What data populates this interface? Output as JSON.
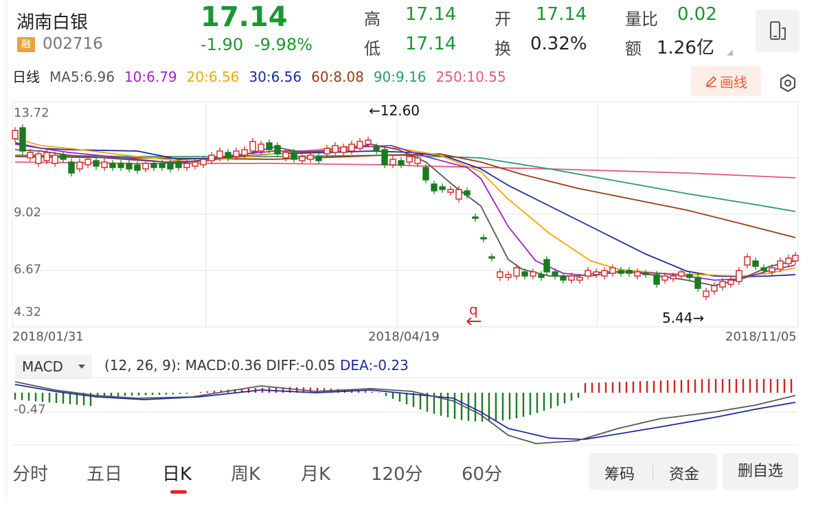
{
  "header": {
    "name": "湖南白银",
    "rong_badge": "融",
    "code": "002716",
    "price": "17.14",
    "change": "-1.90",
    "change_pct": "-9.98%",
    "stats": {
      "high_label": "高",
      "high": "17.14",
      "open_label": "开",
      "open": "17.14",
      "vol_ratio_label": "量比",
      "vol_ratio": "0.02",
      "low_label": "低",
      "low": "17.14",
      "turnover_label": "换",
      "turnover": "0.32%",
      "amount_label": "额",
      "amount": "1.26亿"
    },
    "switch_icon": "phone-landscape-icon"
  },
  "ma_bar": {
    "period": "日线",
    "ma5": "MA5:6.96",
    "ma10": "10:6.79",
    "ma20": "20:6.56",
    "ma30": "30:6.56",
    "ma60": "60:8.08",
    "ma90": "90:9.16",
    "ma250": "250:10.55",
    "draw_label": "画线",
    "colors": {
      "ma5": "#555555",
      "ma10": "#a020c8",
      "ma20": "#f0a800",
      "ma30": "#1a2aa0",
      "ma60": "#9a3a10",
      "ma90": "#2a9a70",
      "ma250": "#e05a78"
    }
  },
  "kline": {
    "y_ticks": [
      "13.72",
      "9.02",
      "6.67",
      "4.32"
    ],
    "dates": [
      "2018/01/31",
      "2018/04/19",
      "2018/11/05"
    ],
    "high_marker": "←12.60",
    "low_marker": "5.44→",
    "q_marker": "q",
    "up_color": "#d42020",
    "down_color": "#1a7a20"
  },
  "macd": {
    "selector": "MACD",
    "params": "(12, 26, 9):",
    "macd": "MACD:0.36",
    "diff": "DIFF:-0.05",
    "dea": "DEA:-0.23",
    "y_tick": "-0.47"
  },
  "tabs": [
    "分时",
    "五日",
    "日K",
    "周K",
    "月K",
    "120分",
    "60分"
  ],
  "active_tab": "日K",
  "actions": {
    "chips": "筹码",
    "funds": "资金",
    "remove": "删自选"
  }
}
